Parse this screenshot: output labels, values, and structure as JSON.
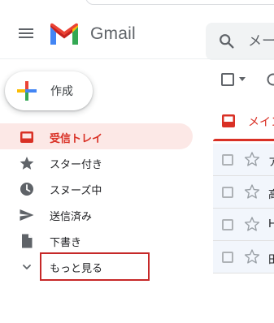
{
  "header": {
    "logo_text": "Gmail",
    "search_placeholder": "メー"
  },
  "compose": {
    "label": "作成"
  },
  "nav": {
    "items": [
      {
        "label": "受信トレイ",
        "icon": "inbox-icon",
        "active": true
      },
      {
        "label": "スター付き",
        "icon": "star-icon",
        "active": false
      },
      {
        "label": "スヌーズ中",
        "icon": "clock-icon",
        "active": false
      },
      {
        "label": "送信済み",
        "icon": "send-icon",
        "active": false
      },
      {
        "label": "下書き",
        "icon": "draft-icon",
        "active": false
      },
      {
        "label": "もっと見る",
        "icon": "chevron-down-icon",
        "active": false
      }
    ]
  },
  "tabs": {
    "primary_label": "メイン"
  },
  "emails": [
    {
      "sender": "ア"
    },
    {
      "sender": "高"
    },
    {
      "sender": "H"
    },
    {
      "sender": "田"
    }
  ],
  "colors": {
    "accent_red": "#d93025",
    "active_bg": "#fce8e6",
    "highlight_box": "#c62828"
  }
}
